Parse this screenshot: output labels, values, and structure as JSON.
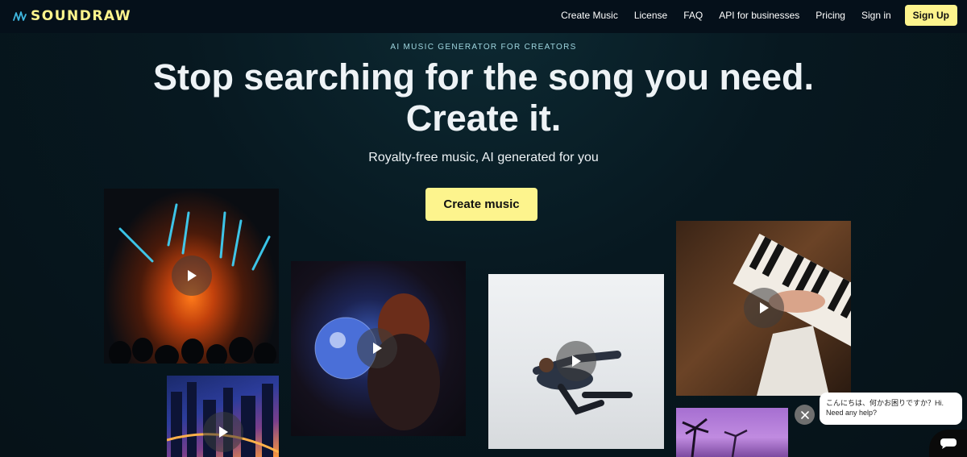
{
  "header": {
    "logo_text": "SOUNDRAW",
    "nav": [
      {
        "label": "Create Music"
      },
      {
        "label": "License"
      },
      {
        "label": "FAQ"
      },
      {
        "label": "API for businesses"
      },
      {
        "label": "Pricing"
      },
      {
        "label": "Sign in"
      }
    ],
    "signup_label": "Sign Up"
  },
  "hero": {
    "eyebrow": "AI MUSIC GENERATOR FOR CREATORS",
    "headline_line1": "Stop searching for the song you need.",
    "headline_line2": "Create it.",
    "subline": "Royalty-free music, AI generated for you",
    "cta_label": "Create music"
  },
  "tiles": [
    {
      "name": "concert",
      "icon": "play-icon"
    },
    {
      "name": "city-night",
      "icon": "play-icon"
    },
    {
      "name": "disco-ball",
      "icon": "play-icon"
    },
    {
      "name": "dancer",
      "icon": "play-icon"
    },
    {
      "name": "piano",
      "icon": "play-icon"
    },
    {
      "name": "palm-trees",
      "icon": "play-icon"
    }
  ],
  "chat": {
    "message": "こんにちは、何かお困りですか？Hi. Need any help?",
    "close_icon": "close-icon",
    "launcher_icon": "chat-icon"
  },
  "colors": {
    "accent": "#fdf48d",
    "background": "#071820",
    "header": "#05101a"
  }
}
